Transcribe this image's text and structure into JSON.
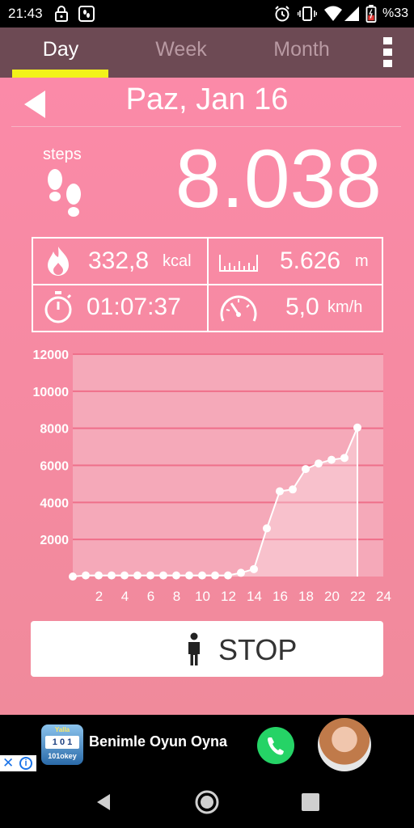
{
  "status_bar": {
    "time": "21:43",
    "battery_percent": "%33",
    "icons": [
      "lock-icon",
      "fitness-app-icon",
      "alarm-icon",
      "vibrate-icon",
      "wifi-icon",
      "signal-icon",
      "battery-icon"
    ]
  },
  "tabs": [
    {
      "label": "Day",
      "selected": true
    },
    {
      "label": "Week",
      "selected": false
    },
    {
      "label": "Month",
      "selected": false
    }
  ],
  "date": {
    "title": "Paz, Jan 16"
  },
  "steps": {
    "label": "steps",
    "value": "8.038"
  },
  "stats": {
    "calories": {
      "value": "332,8",
      "unit": "kcal"
    },
    "distance": {
      "value": "5.626",
      "unit": "m"
    },
    "duration": {
      "value": "01:07:37"
    },
    "speed": {
      "value": "5,0",
      "unit": "km/h"
    }
  },
  "chart_data": {
    "type": "area",
    "x": [
      0,
      1,
      2,
      3,
      4,
      5,
      6,
      7,
      8,
      9,
      10,
      11,
      12,
      13,
      14,
      15,
      16,
      17,
      18,
      19,
      20,
      21,
      22
    ],
    "y": [
      0,
      60,
      60,
      60,
      60,
      60,
      60,
      60,
      60,
      60,
      60,
      60,
      60,
      200,
      400,
      2600,
      4600,
      4700,
      5800,
      6100,
      6300,
      6400,
      8038
    ],
    "xticks": [
      2,
      4,
      6,
      8,
      10,
      12,
      14,
      16,
      18,
      20,
      22,
      24
    ],
    "yticks": [
      2000,
      4000,
      6000,
      8000,
      10000,
      12000
    ],
    "xlim": [
      0,
      24
    ],
    "ylim": [
      0,
      12000
    ],
    "grid": true,
    "colors": {
      "line": "#ffffff",
      "grid": "#ef6f8a",
      "plot_bg": "#f5a9b9"
    }
  },
  "stop_button": {
    "label": "STOP"
  },
  "ad": {
    "text": "Benimle Oyun Oyna",
    "game_badge_top": "Yalla",
    "game_tiles": "1 0 1",
    "game_brand": "101okey"
  },
  "nav": [
    "back-button",
    "home-button",
    "recents-button"
  ],
  "colors": {
    "accent": "#f2f219",
    "appbar": "#6d4a54",
    "main_bg": "#fb8aa8"
  }
}
